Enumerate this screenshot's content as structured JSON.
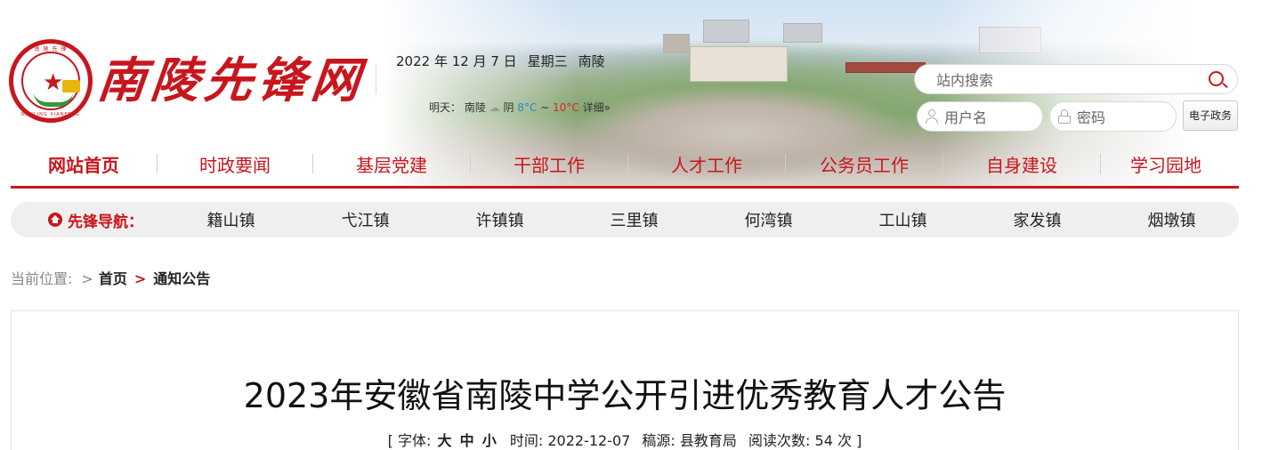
{
  "site": {
    "logo_text": "南陵先锋网",
    "emblem_ring_top": "南 陵 先 锋",
    "emblem_ring_bottom": "NANLING XIANFENG"
  },
  "header": {
    "date": "2022 年 12 月 7 日",
    "weekday": "星期三",
    "city": "南陵",
    "weather": {
      "day_label": "明天：",
      "city": "南陵",
      "condition": "阴",
      "low": "8°C",
      "tilde": "~",
      "high": "10°C",
      "details_link": "详细»"
    }
  },
  "search": {
    "placeholder": "站内搜索"
  },
  "login": {
    "username_placeholder": "用户名",
    "password_placeholder": "密码",
    "egov_button": "电子政务"
  },
  "main_nav": [
    {
      "label": "网站首页",
      "active": true
    },
    {
      "label": "时政要闻"
    },
    {
      "label": "基层党建"
    },
    {
      "label": "干部工作"
    },
    {
      "label": "人才工作"
    },
    {
      "label": "公务员工作"
    },
    {
      "label": "自身建设"
    },
    {
      "label": "学习园地"
    }
  ],
  "vanguard_nav": {
    "title": "先锋导航：",
    "items": [
      "籍山镇",
      "弋江镇",
      "许镇镇",
      "三里镇",
      "何湾镇",
      "工山镇",
      "家发镇",
      "烟墩镇"
    ]
  },
  "breadcrumb": {
    "label": "当前位置:",
    "sep": ">",
    "home": "首页",
    "current": "通知公告"
  },
  "article": {
    "title": "2023年安徽省南陵中学公开引进优秀教育人才公告",
    "meta": {
      "open": "[",
      "font_label": "字体:",
      "size_large": "大",
      "size_medium": "中",
      "size_small": "小",
      "time_label": "时间:",
      "time": "2022-12-07",
      "source_label": "稿源:",
      "source": "县教育局",
      "reads_label": "阅读次数:",
      "reads": "54",
      "reads_unit": "次",
      "close": "]"
    }
  },
  "colors": {
    "brand_red": "#c8161d",
    "nav_bg": "#efefef"
  }
}
